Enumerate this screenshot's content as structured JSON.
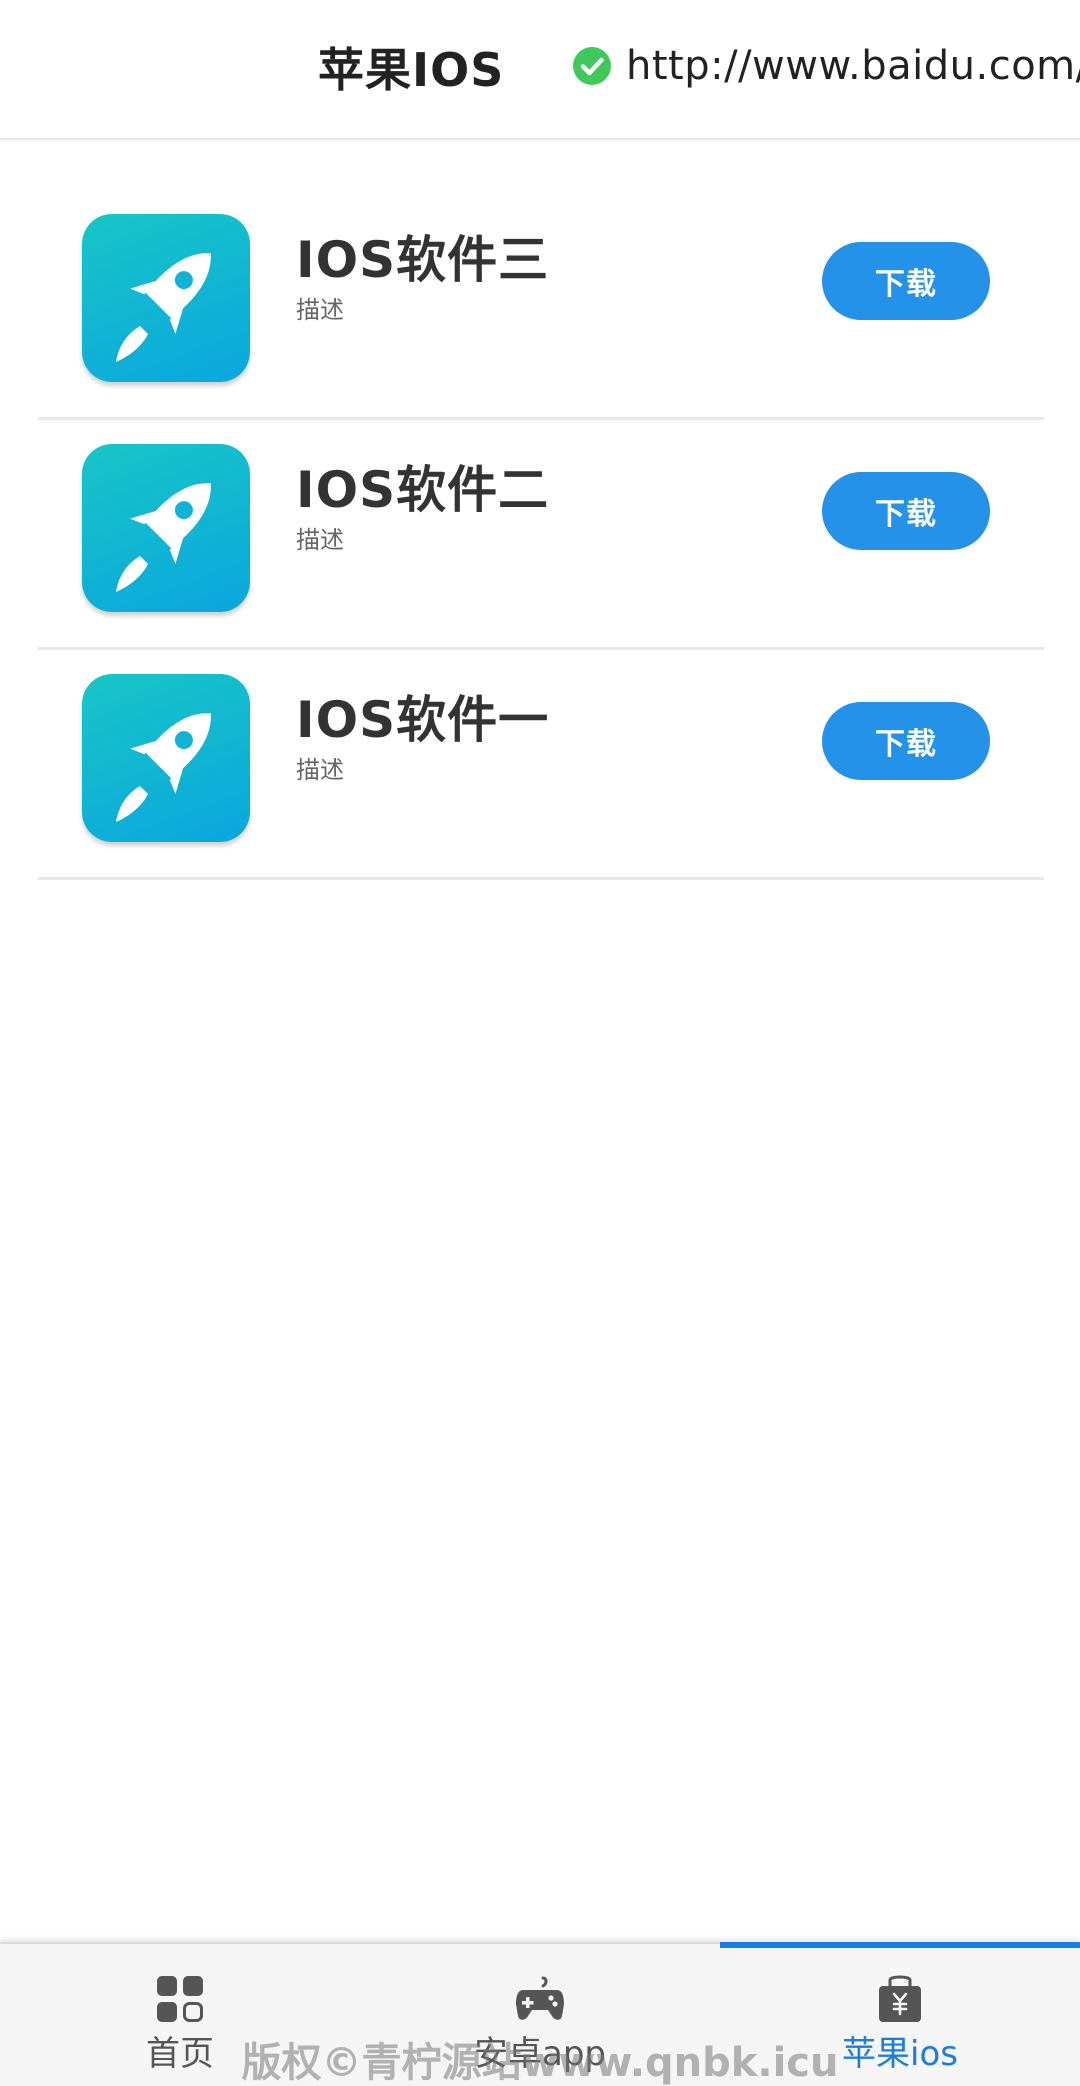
{
  "header": {
    "title": "苹果IOS",
    "url": "http://www.baidu.com/",
    "check_icon": "verified-check-icon"
  },
  "apps": [
    {
      "name": "IOS软件三",
      "desc": "描述",
      "button": "下载",
      "icon": "rocket-icon"
    },
    {
      "name": "IOS软件二",
      "desc": "描述",
      "button": "下载",
      "icon": "rocket-icon"
    },
    {
      "name": "IOS软件一",
      "desc": "描述",
      "button": "下载",
      "icon": "rocket-icon"
    }
  ],
  "tabbar": {
    "tabs": [
      {
        "label": "首页",
        "icon": "grid-apps-icon",
        "active": false
      },
      {
        "label": "安卓app",
        "icon": "gamepad-icon",
        "active": false
      },
      {
        "label": "苹果ios",
        "icon": "app-store-bag-icon",
        "active": true
      }
    ]
  },
  "watermark": "版权©青柠源站www.qnbk.icu",
  "colors": {
    "accent": "#2592ea",
    "active_tab": "#1a7ee0",
    "icon_gradient_start": "#17c6c6",
    "icon_gradient_end": "#0aa6de",
    "check": "#3ec95a"
  }
}
